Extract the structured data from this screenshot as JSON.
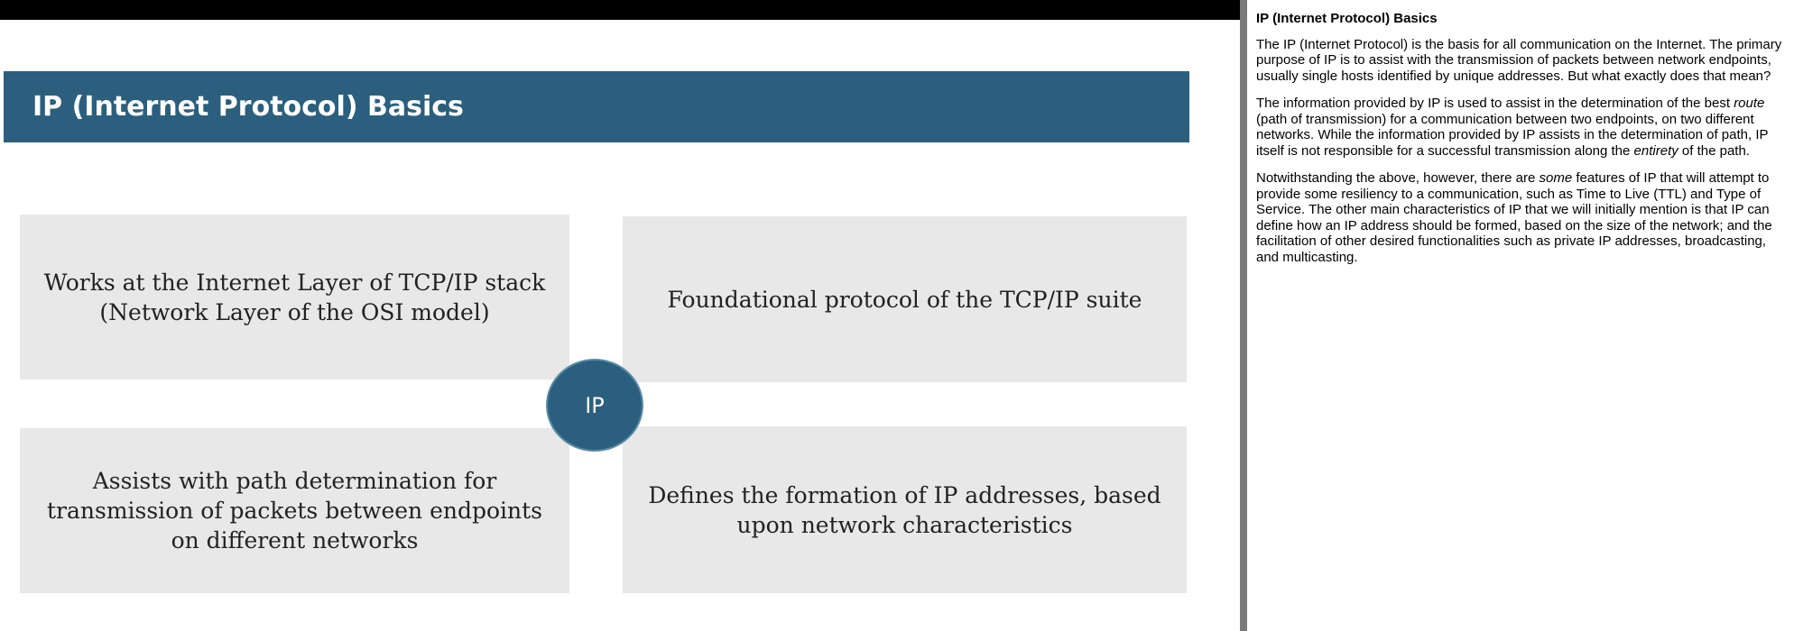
{
  "slide": {
    "title": "IP (Internet Protocol) Basics",
    "center_label": "IP",
    "boxes": {
      "top_left": "Works at the Internet Layer of TCP/IP stack (Network Layer of the OSI model)",
      "top_right": "Foundational protocol of the TCP/IP suite",
      "bottom_left": "Assists with path determination for transmission of packets between endpoints on different networks",
      "bottom_right": "Defines the formation of IP addresses, based upon network characteristics"
    },
    "colors": {
      "banner": "#2c5f7d",
      "box_fill": "#e8e8e8",
      "circle": "#2c5f7d"
    }
  },
  "notes": {
    "title": "IP (Internet Protocol) Basics",
    "p1": "The IP (Internet Protocol) is the basis for all communication on the Internet. The primary purpose of IP is to assist with the transmission of packets between network endpoints, usually single hosts identified by unique addresses. But what exactly does that mean?",
    "p2": {
      "a": "The information provided by IP is used to assist in the determination of the best ",
      "b": "route",
      "c": " (path of transmission) for a communication between two endpoints, on two different networks. While the information provided by IP assists in the determination of path, IP itself is not responsible for a successful transmission along the ",
      "d": "entirety",
      "e": " of the path."
    },
    "p3": {
      "a": "Notwithstanding the above, however, there are ",
      "b": "some",
      "c": " features of IP that will attempt to provide some resiliency to a communication, such as Time to Live (TTL) and Type of Service. The other main characteristics of IP that we will initially mention is that IP can define how an IP address should be formed, based on the size of the network; and the facilitation of other desired functionalities such as private IP addresses, broadcasting, and multicasting."
    }
  }
}
